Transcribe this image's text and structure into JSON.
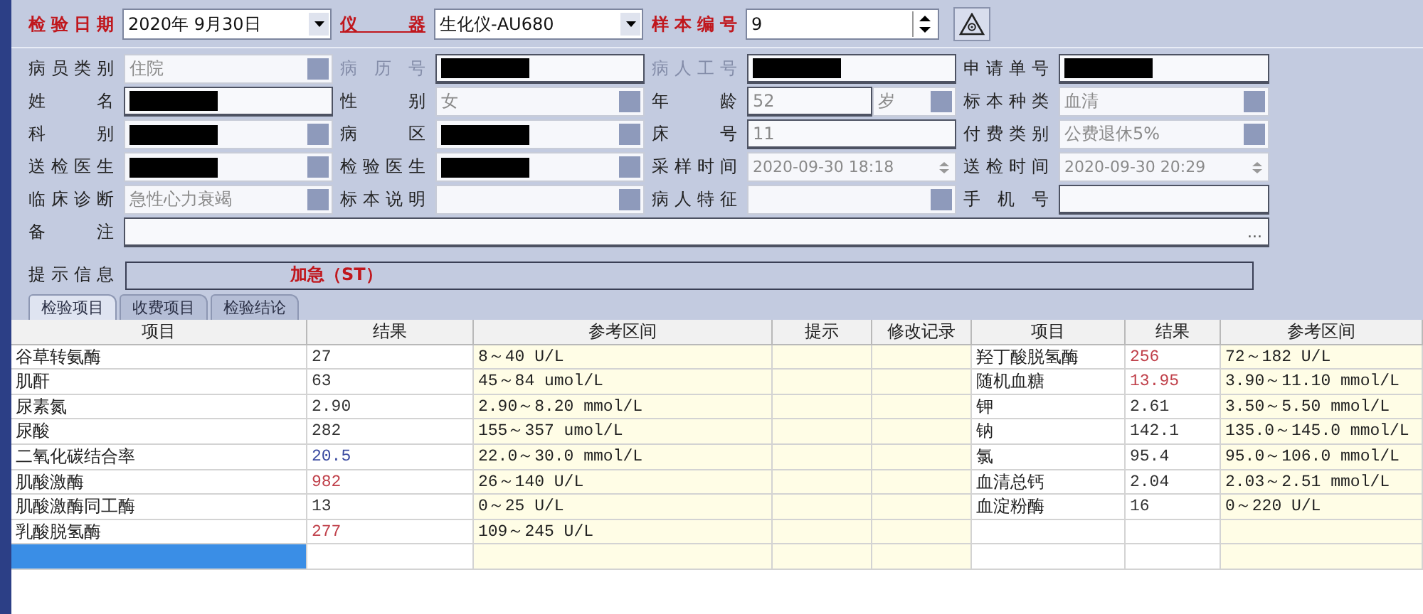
{
  "header": {
    "date_label": "检验日期",
    "date": "2020年 9月30日",
    "instrument_label": "仪 器",
    "instrument": "生化仪-AU680",
    "sample_label": "样本编号",
    "sample_no": "9"
  },
  "form_rows": [
    [
      {
        "label": "病员类别",
        "label_disabled": false,
        "kind": "combo",
        "value": "住院",
        "redacted": false
      },
      {
        "label": "病 历 号",
        "label_disabled": true,
        "kind": "text",
        "redacted": true
      },
      {
        "label": "病人工号",
        "label_disabled": true,
        "kind": "text",
        "redacted": true
      },
      {
        "label": "申请单号",
        "label_disabled": false,
        "kind": "text",
        "redacted": true
      }
    ],
    [
      {
        "label": "姓 名",
        "label_disabled": false,
        "kind": "text",
        "redacted": true
      },
      {
        "label": "性 别",
        "label_disabled": false,
        "kind": "combo",
        "value": "女",
        "redacted": false
      },
      {
        "label": "年 龄",
        "label_disabled": false,
        "kind": "age",
        "value": "52",
        "unit": "岁",
        "redacted": false
      },
      {
        "label": "标本种类",
        "label_disabled": false,
        "kind": "combo",
        "value": "血清",
        "redacted": false
      }
    ],
    [
      {
        "label": "科 别",
        "label_disabled": false,
        "kind": "combo",
        "redacted": true
      },
      {
        "label": "病 区",
        "label_disabled": false,
        "kind": "combo",
        "redacted": true
      },
      {
        "label": "床 号",
        "label_disabled": false,
        "kind": "text",
        "value": "11",
        "redacted": false
      },
      {
        "label": "付费类别",
        "label_disabled": false,
        "kind": "combo",
        "value": "公费退休5%",
        "redacted": false
      }
    ],
    [
      {
        "label": "送检医生",
        "label_disabled": false,
        "kind": "combo",
        "redacted": true
      },
      {
        "label": "检验医生",
        "label_disabled": false,
        "kind": "combo",
        "redacted": true
      },
      {
        "label": "采样时间",
        "label_disabled": false,
        "kind": "spin",
        "value": "2020-09-30 18:18",
        "redacted": false
      },
      {
        "label": "送检时间",
        "label_disabled": false,
        "kind": "spin",
        "value": "2020-09-30 20:29",
        "redacted": false
      }
    ],
    [
      {
        "label": "临床诊断",
        "label_disabled": false,
        "kind": "combo",
        "value": "急性心力衰竭",
        "redacted": false
      },
      {
        "label": "标本说明",
        "label_disabled": false,
        "kind": "combo",
        "redacted": false
      },
      {
        "label": "病人特征",
        "label_disabled": false,
        "kind": "combo",
        "redacted": false
      },
      {
        "label": "手 机 号",
        "label_disabled": false,
        "kind": "text",
        "redacted": false
      }
    ]
  ],
  "remarks": {
    "label": "备 注",
    "button": "..."
  },
  "hint": {
    "label": "提示信息",
    "text": "加急（ST）"
  },
  "tabs": [
    {
      "label": "检验项目",
      "selected": true
    },
    {
      "label": "收费项目",
      "selected": false
    },
    {
      "label": "检验结论",
      "selected": false
    }
  ],
  "left_table": {
    "columns": [
      "项目",
      "结果",
      "参考区间",
      "提示",
      "修改记录"
    ],
    "new_row_selected": true,
    "rows": [
      {
        "item": "谷草转氨酶",
        "result": "27",
        "color": "#333333",
        "range": "8～40 U/L"
      },
      {
        "item": "肌酐",
        "result": "63",
        "color": "#333333",
        "range": "45～84 umol/L"
      },
      {
        "item": "尿素氮",
        "result": "2.90",
        "color": "#333333",
        "range": "2.90～8.20 mmol/L"
      },
      {
        "item": "尿酸",
        "result": "282",
        "color": "#333333",
        "range": "155～357 umol/L"
      },
      {
        "item": "二氧化碳结合率",
        "result": "20.5",
        "color": "#3a4aa0",
        "range": "22.0～30.0 mmol/L"
      },
      {
        "item": "肌酸激酶",
        "result": "982",
        "color": "#c0404a",
        "range": "26～140 U/L"
      },
      {
        "item": "肌酸激酶同工酶",
        "result": "13",
        "color": "#333333",
        "range": "0～25 U/L"
      },
      {
        "item": "乳酸脱氢酶",
        "result": "277",
        "color": "#c0404a",
        "range": "109～245 U/L"
      }
    ]
  },
  "right_table": {
    "columns": [
      "项目",
      "结果",
      "参考区间"
    ],
    "rows": [
      {
        "item": "羟丁酸脱氢酶",
        "result": "256",
        "color": "#c0404a",
        "range": "72～182 U/L"
      },
      {
        "item": "随机血糖",
        "result": "13.95",
        "color": "#c0404a",
        "range": "3.90～11.10 mmol/L"
      },
      {
        "item": "钾",
        "result": "2.61",
        "color": "#333333",
        "range": "3.50～5.50 mmol/L"
      },
      {
        "item": "钠",
        "result": "142.1",
        "color": "#333333",
        "range": "135.0～145.0 mmol/L"
      },
      {
        "item": "氯",
        "result": "95.4",
        "color": "#333333",
        "range": "95.0～106.0 mmol/L"
      },
      {
        "item": "血清总钙",
        "result": "2.04",
        "color": "#333333",
        "range": "2.03～2.51 mmol/L"
      },
      {
        "item": "血淀粉酶",
        "result": "16",
        "color": "#333333",
        "range": "0～220 U/L"
      }
    ]
  }
}
